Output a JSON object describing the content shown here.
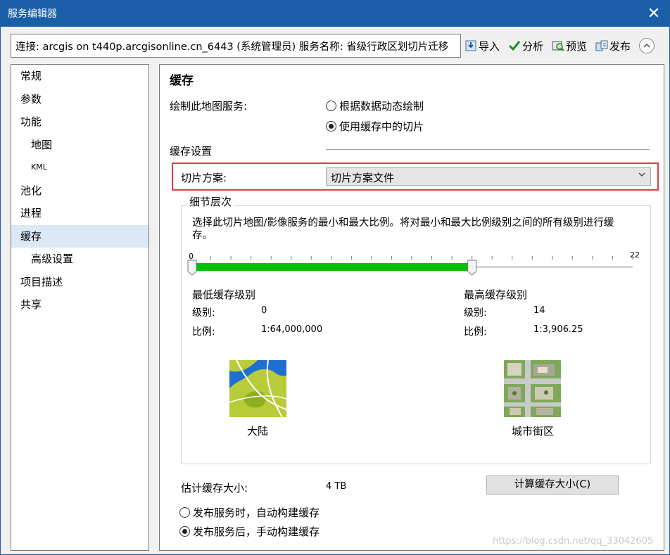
{
  "window": {
    "title": "服务编辑器",
    "close_glyph": "✕"
  },
  "connection": {
    "text": "连接: arcgis on t440p.arcgisonline.cn_6443 (系统管理员)   服务名称: 省级行政区划切片迁移"
  },
  "toolbar": {
    "import": "导入",
    "analyze": "分析",
    "preview": "预览",
    "publish": "发布"
  },
  "sidebar": {
    "items": [
      {
        "label": "常规"
      },
      {
        "label": "参数"
      },
      {
        "label": "功能"
      },
      {
        "label": "地图"
      },
      {
        "label": "KML"
      },
      {
        "label": "池化"
      },
      {
        "label": "进程"
      },
      {
        "label": "缓存"
      },
      {
        "label": "高级设置"
      },
      {
        "label": "项目描述"
      },
      {
        "label": "共享"
      }
    ]
  },
  "main": {
    "title": "缓存",
    "draw_label": "绘制此地图服务:",
    "draw_options": [
      "根据数据动态绘制",
      "使用缓存中的切片"
    ],
    "draw_selected_index": 1,
    "cache_settings": "缓存设置",
    "tiling_label": "切片方案:",
    "tiling_value": "切片方案文件",
    "detail_group": "细节层次",
    "detail_desc_line1": "选择此切片地图/影像服务的最小和最大比例。将对最小和最大比例级别之间的所有级别进行缓",
    "detail_desc_line2": "存。",
    "slider": {
      "min_label": "0",
      "max_label": "22",
      "min": 0,
      "max": 22,
      "low": 0,
      "high": 14
    },
    "min_cache": {
      "heading": "最低缓存级别",
      "level_label": "级别:",
      "level_value": "0",
      "scale_label": "比例:",
      "scale_value": "1:64,000,000",
      "image_caption": "大陆"
    },
    "max_cache": {
      "heading": "最高缓存级别",
      "level_label": "级别:",
      "level_value": "14",
      "scale_label": "比例:",
      "scale_value": "1:3,906.25",
      "image_caption": "城市街区"
    },
    "estimate_label": "估计缓存大小:",
    "estimate_value": "4 TB",
    "calc_button": "计算缓存大小(C)",
    "build_options": [
      "发布服务时，自动构建缓存",
      "发布服务后，手动构建缓存"
    ],
    "build_selected_index": 1
  },
  "watermark": "https://blog.csdn.net/qq_33042605",
  "colors": {
    "titlebar": "#1a5ea8",
    "slider_fill": "#00c000",
    "highlight_box": "#e53c3c",
    "selected_item": "#dbe9f6"
  }
}
